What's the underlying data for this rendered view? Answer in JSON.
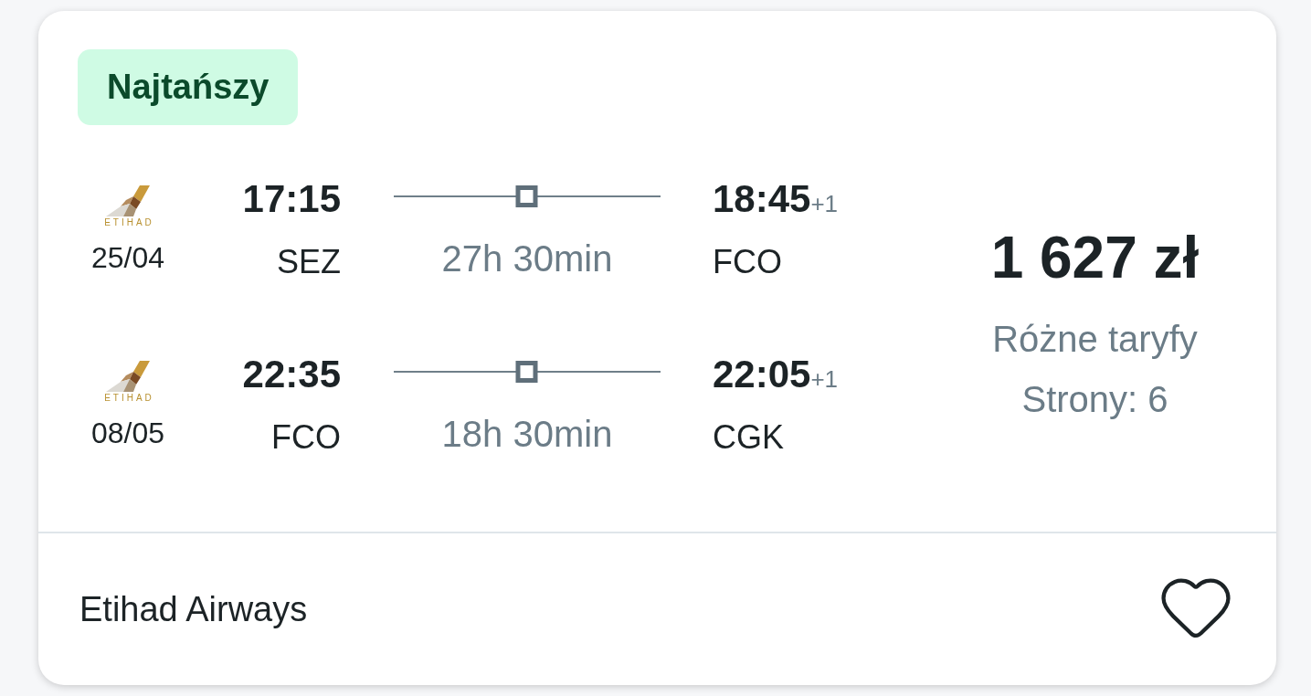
{
  "badge": {
    "label": "Najtańszy"
  },
  "legs": [
    {
      "logo_text": "ETIHAD",
      "date": "25/04",
      "departure_time": "17:15",
      "departure_airport": "SEZ",
      "duration": "27h 30min",
      "arrival_time": "18:45",
      "day_offset": "+1",
      "arrival_airport": "FCO"
    },
    {
      "logo_text": "ETIHAD",
      "date": "08/05",
      "departure_time": "22:35",
      "departure_airport": "FCO",
      "duration": "18h 30min",
      "arrival_time": "22:05",
      "day_offset": "+1",
      "arrival_airport": "CGK"
    }
  ],
  "price": {
    "amount": "1 627 zł",
    "fare_note": "Różne taryfy",
    "sites": "Strony: 6"
  },
  "footer": {
    "airline": "Etihad Airways",
    "saved": false
  }
}
